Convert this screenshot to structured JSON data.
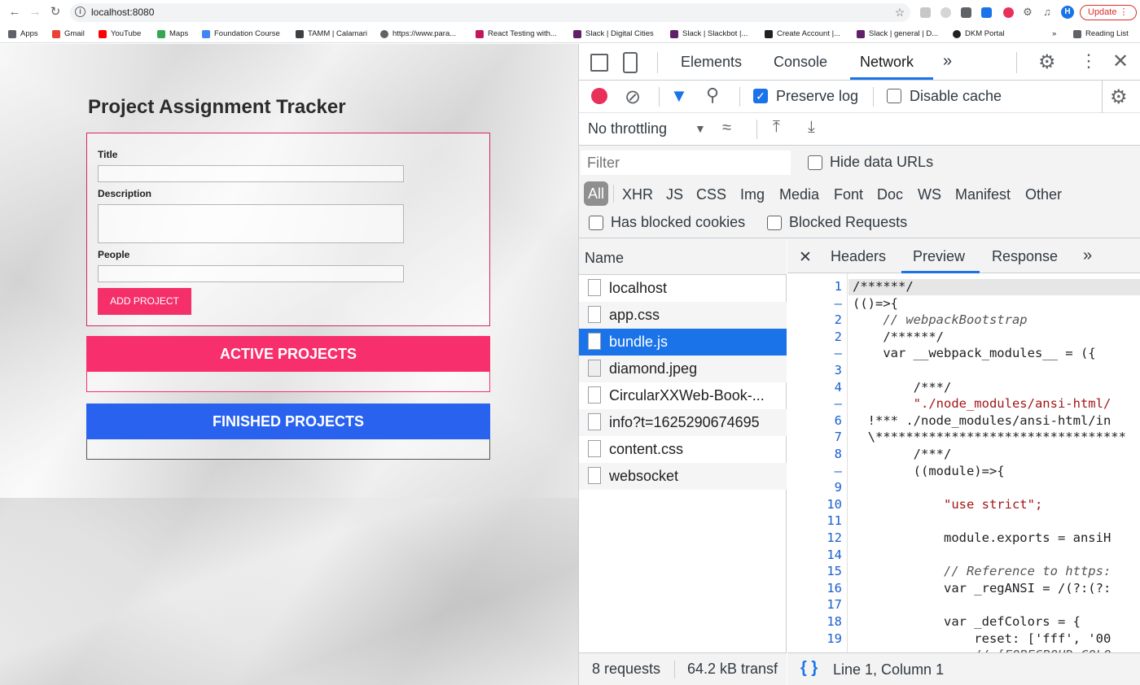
{
  "browser": {
    "url": "localhost:8080",
    "update_label": "Update",
    "profile_initial": "H",
    "bookmarks": [
      {
        "label": "Apps",
        "color": "#5f6368"
      },
      {
        "label": "Gmail",
        "color": "#ea4335"
      },
      {
        "label": "YouTube",
        "color": "#ff0000"
      },
      {
        "label": "Maps",
        "color": "#34a853"
      },
      {
        "label": "Foundation Course",
        "color": "#4285f4"
      },
      {
        "label": "TAMM | Calamari",
        "color": "#3c4043"
      },
      {
        "label": "https://www.para...",
        "color": "#5f6368"
      },
      {
        "label": "React Testing with...",
        "color": "#c2185b"
      },
      {
        "label": "Slack | Digital Cities",
        "color": "#611f69"
      },
      {
        "label": "Slack | Slackbot |...",
        "color": "#611f69"
      },
      {
        "label": "Create Account |...",
        "color": "#202124"
      },
      {
        "label": "Slack | general | D...",
        "color": "#611f69"
      },
      {
        "label": "DKM Portal",
        "color": "#202124"
      }
    ],
    "bookmarks_more": "»",
    "reading_list": "Reading List"
  },
  "app": {
    "title": "Project Assignment Tracker",
    "form": {
      "title_label": "Title",
      "description_label": "Description",
      "people_label": "People",
      "title_value": "",
      "description_value": "",
      "people_value": "",
      "submit_label": "ADD PROJECT"
    },
    "active_header": "ACTIVE PROJECTS",
    "finished_header": "FINISHED PROJECTS",
    "colors": {
      "active": "#f72f6c",
      "finished": "#2862ef",
      "button": "#f52f6a"
    }
  },
  "devtools": {
    "tabs": [
      "Elements",
      "Console",
      "Network"
    ],
    "active_tab": "Network",
    "more_tabs": "»",
    "preserve_log_label": "Preserve log",
    "preserve_log_checked": true,
    "disable_cache_label": "Disable cache",
    "throttling": "No throttling",
    "filter_placeholder": "Filter",
    "hide_data_urls_label": "Hide data URLs",
    "filter_types": [
      "All",
      "XHR",
      "JS",
      "CSS",
      "Img",
      "Media",
      "Font",
      "Doc",
      "WS",
      "Manifest",
      "Other"
    ],
    "has_blocked_cookies_label": "Has blocked cookies",
    "blocked_requests_label": "Blocked Requests",
    "name_header": "Name",
    "requests": [
      "localhost",
      "app.css",
      "bundle.js",
      "diamond.jpeg",
      "CircularXXWeb-Book-...",
      "info?t=1625290674695",
      "content.css",
      "websocket"
    ],
    "selected_request": "bundle.js",
    "requests_count": "8 requests",
    "transferred": "64.2 kB transf",
    "detail_tabs": [
      "Headers",
      "Preview",
      "Response"
    ],
    "active_detail_tab": "Preview",
    "cursor_position": "Line 1, Column 1",
    "code_lines": [
      {
        "ln": "1",
        "text": "/******/"
      },
      {
        "ln": "–",
        "text": "(()=>{"
      },
      {
        "ln": "2",
        "text": "    // webpackBootstrap"
      },
      {
        "ln": "2",
        "text": "    /******/"
      },
      {
        "ln": "–",
        "text": "    var __webpack_modules__ = ({"
      },
      {
        "ln": "3",
        "text": ""
      },
      {
        "ln": "4",
        "text": "        /***/"
      },
      {
        "ln": "–",
        "text": "        \"./node_modules/ansi-html/"
      },
      {
        "ln": "6",
        "text": "  !*** ./node_modules/ansi-html/in"
      },
      {
        "ln": "7",
        "text": "  \\*********************************"
      },
      {
        "ln": "8",
        "text": "        /***/"
      },
      {
        "ln": "–",
        "text": "        ((module)=>{"
      },
      {
        "ln": "9",
        "text": ""
      },
      {
        "ln": "10",
        "text": "            \"use strict\";"
      },
      {
        "ln": "11",
        "text": ""
      },
      {
        "ln": "12",
        "text": "            module.exports = ansiH"
      },
      {
        "ln": "14",
        "text": ""
      },
      {
        "ln": "15",
        "text": "            // Reference to https:"
      },
      {
        "ln": "16",
        "text": "            var _regANSI = /(?:(?:"
      },
      {
        "ln": "17",
        "text": ""
      },
      {
        "ln": "18",
        "text": "            var _defColors = {"
      },
      {
        "ln": "19",
        "text": "                reset: ['fff', '00"
      },
      {
        "ln": "–",
        "text": "                // [FOREGROUD_COLO"
      }
    ]
  }
}
